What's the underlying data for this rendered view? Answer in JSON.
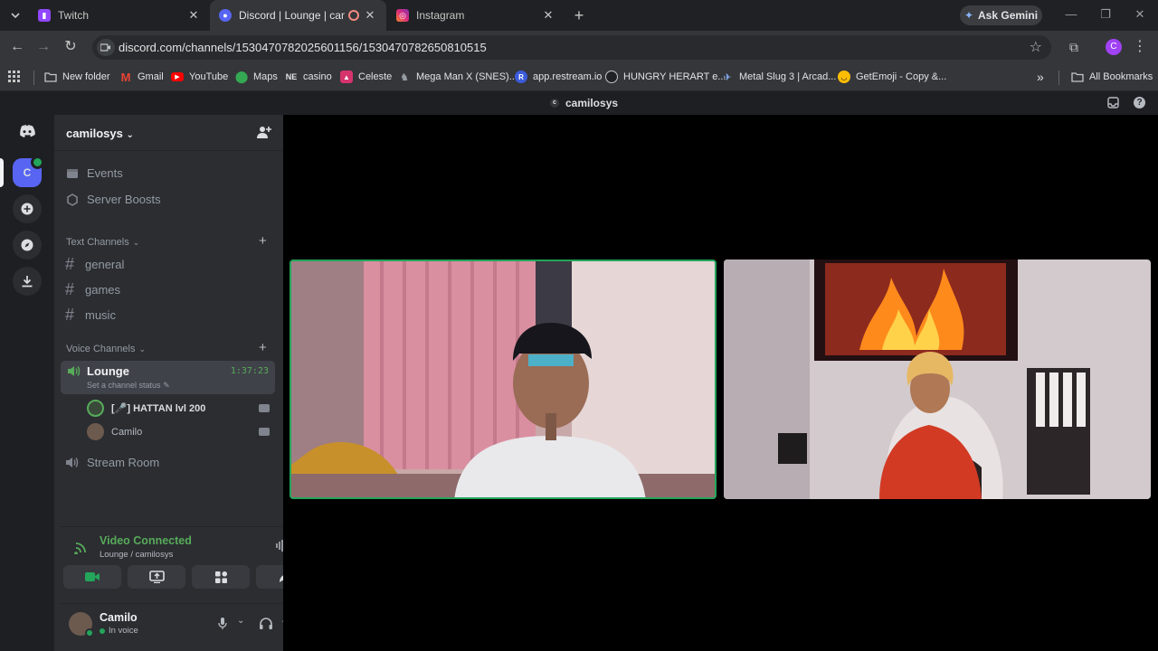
{
  "browser": {
    "tabs": [
      {
        "title": "Twitch",
        "active": false
      },
      {
        "title": "Discord | Lounge | camilosys",
        "active": true
      },
      {
        "title": "Instagram",
        "active": false
      }
    ],
    "ask_gemini": "Ask Gemini",
    "url": "discord.com/channels/1530470782025601156/1530470782650810515",
    "profile_initial": "C",
    "bookmarks": [
      {
        "label": "New folder",
        "icon": "folder-icon"
      },
      {
        "label": "Gmail",
        "icon": "gmail-icon"
      },
      {
        "label": "YouTube",
        "icon": "youtube-icon"
      },
      {
        "label": "Maps",
        "icon": "maps-icon"
      },
      {
        "label": "casino",
        "icon": "ne-icon",
        "icon_text": "NE"
      },
      {
        "label": "Celeste",
        "icon": "celeste-icon"
      },
      {
        "label": "Mega Man X (SNES)...",
        "icon": "megaman-icon"
      },
      {
        "label": "app.restream.io",
        "icon": "restream-icon",
        "icon_text": "R"
      },
      {
        "label": "HUNGRY HERART e...",
        "icon": "hungry-icon"
      },
      {
        "label": "Metal Slug 3 | Arcad...",
        "icon": "metalslug-icon"
      },
      {
        "label": "GetEmoji - Copy &...",
        "icon": "emoji-icon"
      }
    ],
    "all_bookmarks": "All Bookmarks"
  },
  "discord": {
    "window_title": "camilosys",
    "window_title_initial": "c",
    "server": {
      "name": "camilosys",
      "initial": "C"
    },
    "menu": [
      {
        "label": "Events",
        "icon": "calendar-icon"
      },
      {
        "label": "Server Boosts",
        "icon": "boost-icon"
      }
    ],
    "text_category": "Text Channels",
    "text_channels": [
      "general",
      "games",
      "music"
    ],
    "voice_category": "Voice Channels",
    "lounge": {
      "name": "Lounge",
      "timer": "1:37:23",
      "status": "Set a channel status"
    },
    "voice_users": [
      {
        "name": "[🎤] HATTAN lvl 200",
        "avatar": "hattan-avatar"
      },
      {
        "name": "Camilo",
        "avatar": "camilo-avatar"
      }
    ],
    "stream_room": "Stream Room",
    "connection": {
      "status": "Video Connected",
      "location": "Lounge / camilosys"
    },
    "user": {
      "name": "Camilo",
      "status": "In voice"
    },
    "colors": {
      "accent": "#5865f2",
      "green": "#23a55a",
      "connected": "#57ab5a"
    }
  }
}
